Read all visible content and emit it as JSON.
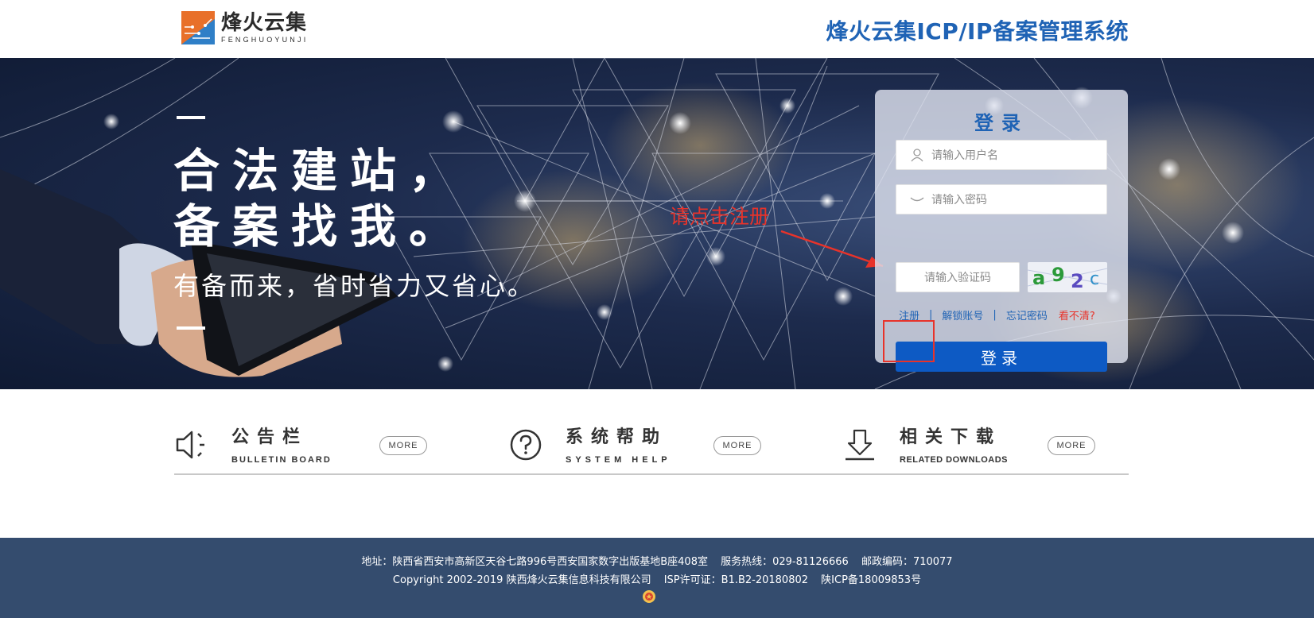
{
  "header": {
    "logo_cn": "烽火云集",
    "logo_en": "FENGHUOYUNJI",
    "system_title": "烽火云集ICP/IP备案管理系统"
  },
  "banner": {
    "slogan_line1": "合法建站，",
    "slogan_line2": "备案找我。",
    "slogan_sub": "有备而来，省时省力又省心。",
    "annotation": "请点击注册"
  },
  "login": {
    "title": "登录",
    "username_placeholder": "请输入用户名",
    "password_placeholder": "请输入密码",
    "captcha_placeholder": "请输入验证码",
    "captcha_text": "a92c",
    "register_link": "注册",
    "unlock_link": "解锁账号",
    "forgot_link": "忘记密码",
    "cant_see_link": "看不清?",
    "separator": "|",
    "submit_label": "登录"
  },
  "info": {
    "bulletin": {
      "cn": "公告栏",
      "en": "BULLETIN BOARD",
      "more": "MORE"
    },
    "help": {
      "cn": "系统帮助",
      "en": "SYSTEM HELP",
      "more": "MORE"
    },
    "downloads": {
      "cn": "相关下载",
      "en": "RELATED DOWNLOADS",
      "more": "MORE"
    }
  },
  "footer": {
    "address": "地址：陕西省西安市高新区天谷七路996号西安国家数字出版基地B座408室",
    "hotline": "服务热线：029-81126666",
    "postcode": "邮政编码：710077",
    "copyright": "Copyright 2002-2019 陕西烽火云集信息科技有限公司",
    "isp": "ISP许可证：B1.B2-20180802",
    "icp": "陕ICP备18009853号"
  },
  "colors": {
    "brand_blue": "#1f63b5",
    "button_blue": "#0d5ac4",
    "annotation_red": "#e8332a",
    "footer_bg": "#344c6e"
  }
}
